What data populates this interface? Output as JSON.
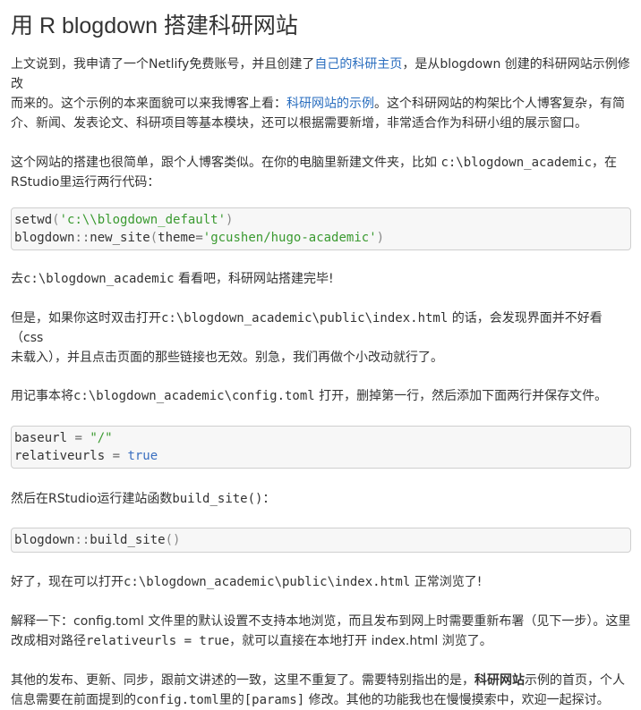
{
  "title": "用 R blogdown 搭建科研网站",
  "p1": {
    "a": "上文说到，我申请了一个Netlify免费账号，并且创建了",
    "link1": "自己的科研主页",
    "b": "，是从blogdown 创建的科研网站示例修改",
    "c": "而来的。这个示例的本来面貌可以来我博客上看：",
    "link2": "科研网站的示例",
    "d": "。这个科研网站的构架比个人博客复杂，有简",
    "e": "介、新闻、发表论文、科研项目等基本模块，还可以根据需要新增，非常适合作为科研小组的展示窗口。"
  },
  "p2": {
    "a": "这个网站的搭建也很简单，跟个人博客类似。在你的电脑里新建文件夹，比如 ",
    "code": "c:\\blogdown_academic",
    "b": "，在",
    "c": "RStudio里运行两行代码："
  },
  "code1": {
    "l1_fn": "setwd",
    "l1_open": "(",
    "l1_str": "'c:\\\\blogdown_default'",
    "l1_close": ")",
    "l2_pkg": "blogdown",
    "l2_sep": "::",
    "l2_fn": "new_site",
    "l2_open": "(",
    "l2_arg": "theme",
    "l2_eq": "=",
    "l2_str": "'gcushen/hugo-academic'",
    "l2_close": ")"
  },
  "p3": {
    "a": "去",
    "code": "c:\\blogdown_academic",
    "b": " 看看吧，科研网站搭建完毕!"
  },
  "p4": {
    "a": "但是，如果你这时双击打开",
    "code": "c:\\blogdown_academic\\public\\index.html",
    "b": " 的话，会发现界面并不好看（css",
    "c": "未载入），并且点击页面的那些链接也无效。别急，我们再做个小改动就行了。"
  },
  "p5": {
    "a": "用记事本将",
    "code": "c:\\blogdown_academic\\config.toml",
    "b": " 打开，删掉第一行，然后添加下面两行并保存文件。"
  },
  "code2": {
    "l1_key": "baseurl",
    "l1_eq": " = ",
    "l1_val": "\"/\"",
    "l2_key": "relativeurls",
    "l2_eq": " = ",
    "l2_val": "true"
  },
  "p6": {
    "a": "然后在RStudio运行建站函数",
    "code": "build_site()",
    "b": "："
  },
  "code3": {
    "pkg": "blogdown",
    "sep": "::",
    "fn": "build_site",
    "parens": "()"
  },
  "p7": {
    "a": "好了，现在可以打开",
    "code": "c:\\blogdown_academic\\public\\index.html",
    "b": " 正常浏览了!"
  },
  "p8": {
    "a": "解释一下：config.toml 文件里的默认设置不支持本地浏览，而且发布到网上时需要重新布署（见下一步）。这里",
    "b": "改成相对路径",
    "code": "relativeurls = true",
    "c": "，就可以直接在本地打开 index.html 浏览了。"
  },
  "p9": {
    "a": "其他的发布、更新、同步，跟前文讲述的一致，这里不重复了。需要特别指出的是，",
    "bold": "科研网站",
    "b": "示例的首页，个人",
    "c": "信息需要在前面提到的",
    "code1": "config.toml",
    "d": "里的",
    "code2": "[params]",
    "e": " 修改。其他的功能我也在慢慢摸索中，欢迎一起探讨。"
  },
  "colors": {
    "text": "#333333",
    "link": "#2a6ebf",
    "string": "#3a9a30",
    "keyword": "#3a6fc0",
    "code_bg": "#f7f7f7"
  }
}
